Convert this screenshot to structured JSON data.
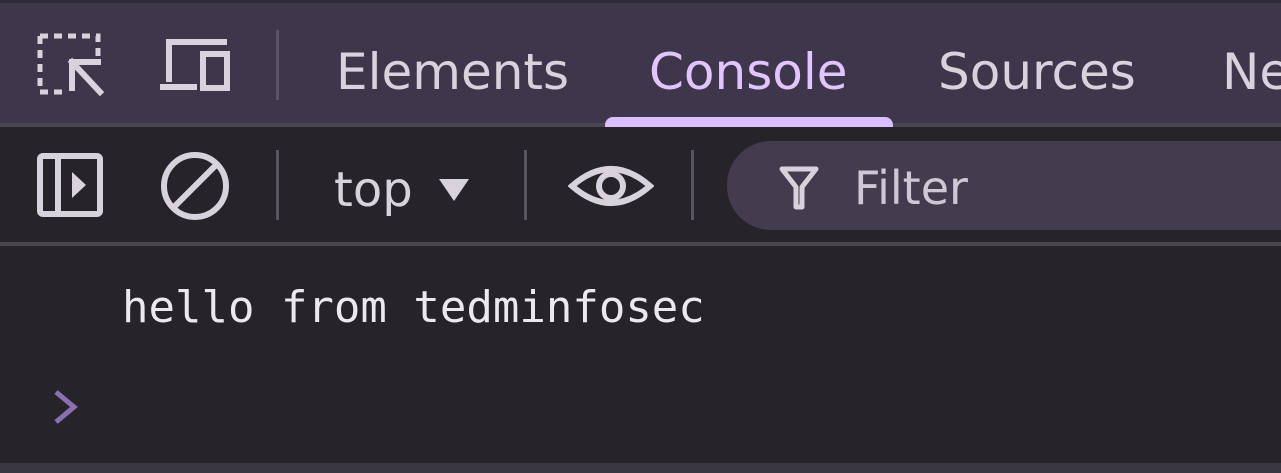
{
  "tabs": [
    {
      "label": "Elements",
      "active": false
    },
    {
      "label": "Console",
      "active": true
    },
    {
      "label": "Sources",
      "active": false
    },
    {
      "label": "Ne",
      "active": false
    }
  ],
  "toolbar": {
    "context_value": "top",
    "filter_placeholder": "Filter"
  },
  "console": {
    "messages": [
      "hello from tedminfosec"
    ]
  },
  "icons": {
    "inspect": "inspect-element-icon",
    "device": "device-toolbar-icon",
    "sidebar": "sidebar-toggle-icon",
    "clear": "clear-console-icon",
    "dropdown": "dropdown-caret-icon",
    "live_expression": "eye-icon",
    "filter": "filter-funnel-icon",
    "prompt": "prompt-chevron-icon"
  },
  "colors": {
    "top_background": "#3e364a",
    "panel_background": "#262329",
    "accent": "#d9bfff",
    "active_tab_text": "#e2c4ff",
    "prompt": "#8a6fb3"
  }
}
